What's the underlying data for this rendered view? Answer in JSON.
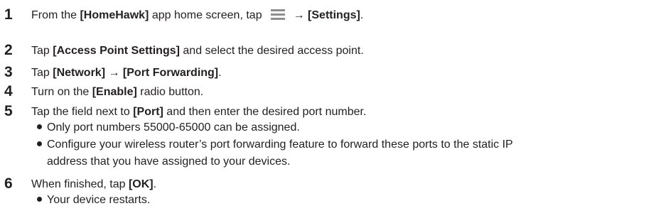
{
  "steps": [
    {
      "number": "1",
      "parts": [
        "From the ",
        "[HomeHawk]",
        " app home screen, tap",
        "→ ",
        "[Settings]",
        "."
      ]
    },
    {
      "number": "2",
      "parts": [
        "Tap ",
        "[Access Point Settings]",
        " and select the desired access point."
      ]
    },
    {
      "number": "3",
      "parts": [
        "Tap ",
        "[Network]",
        " → ",
        "[Port Forwarding]",
        "."
      ]
    },
    {
      "number": "4",
      "parts": [
        "Turn on the ",
        "[Enable]",
        " radio button."
      ]
    },
    {
      "number": "5",
      "parts": [
        "Tap the field next to ",
        "[Port]",
        " and then enter the desired port number."
      ],
      "bullets": [
        "Only port numbers 55000-65000 can be assigned.",
        "Configure your wireless router’s port forwarding feature to forward these ports to the static IP"
      ],
      "continuation": "address that you have assigned to your devices."
    },
    {
      "number": "6",
      "parts": [
        "When finished, tap ",
        "[OK]",
        "."
      ],
      "bullets": [
        "Your device restarts."
      ]
    }
  ],
  "icons": {
    "menu": "menu-icon"
  }
}
